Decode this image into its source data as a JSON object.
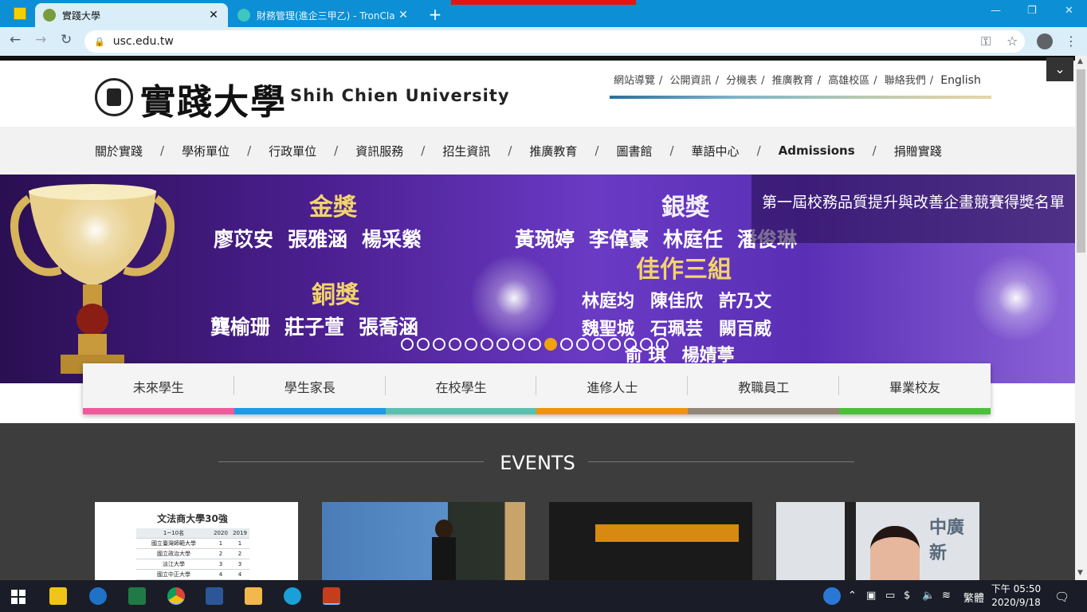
{
  "browser": {
    "tabs": [
      {
        "title": "實踐大學",
        "active": true
      },
      {
        "title": "財務管理(進企三甲乙) - TronCla",
        "active": false
      }
    ],
    "url": "usc.edu.tw"
  },
  "site": {
    "logo_cn": "實踐大學",
    "logo_en": "Shih Chien University",
    "top_links": [
      "網站導覽",
      "公開資訊",
      "分機表",
      "推廣教育",
      "高雄校區",
      "聯絡我們"
    ],
    "top_link_en": "English",
    "main_nav": [
      "關於實踐",
      "學術單位",
      "行政單位",
      "資訊服務",
      "招生資訊",
      "推廣教育",
      "圖書館",
      "華語中心",
      "Admissions",
      "捐贈實踐"
    ]
  },
  "banner": {
    "gold": "金獎",
    "gold_names": [
      "廖苡安",
      "張雅涵",
      "楊采縈"
    ],
    "silver": "銀獎",
    "silver_names": [
      "黃琬婷",
      "李偉豪",
      "林庭任",
      "潘俊琳"
    ],
    "merit": "佳作三組",
    "merit_row1": [
      "林庭均",
      "陳佳欣",
      "許乃文"
    ],
    "merit_row2": [
      "魏聖城",
      "石珮芸",
      "闕百威"
    ],
    "merit_row3": [
      "俞 琪",
      "楊婧葶"
    ],
    "bronze": "銅獎",
    "bronze_names": [
      "龔榆珊",
      "莊子萱",
      "張喬涵"
    ],
    "caption": "第一屆校務品質提升與改善企畫競賽得獎名單",
    "slide_count": 17,
    "active_slide": 10
  },
  "audience": [
    {
      "label": "未來學生",
      "color": "#ee5a9c"
    },
    {
      "label": "學生家長",
      "color": "#1e9ae6"
    },
    {
      "label": "在校學生",
      "color": "#5cc0b0"
    },
    {
      "label": "進修人士",
      "color": "#f0930a"
    },
    {
      "label": "教職員工",
      "color": "#938679"
    },
    {
      "label": "畢業校友",
      "color": "#4cbf3c"
    }
  ],
  "events": {
    "title": "EVENTS",
    "card1": {
      "title": "文法商大學30強",
      "header": [
        "1~10名",
        "2020",
        "2019"
      ],
      "rows": [
        [
          "國立臺灣師範大學",
          "1",
          "1"
        ],
        [
          "國立政治大學",
          "2",
          "2"
        ],
        [
          "淡江大學",
          "3",
          "3"
        ],
        [
          "國立中正大學",
          "4",
          "4"
        ]
      ]
    },
    "card4": {
      "logo": "中廣新"
    }
  },
  "taskbar": {
    "ime": "繁體",
    "time": "下午 05:50",
    "date": "2020/9/18"
  }
}
